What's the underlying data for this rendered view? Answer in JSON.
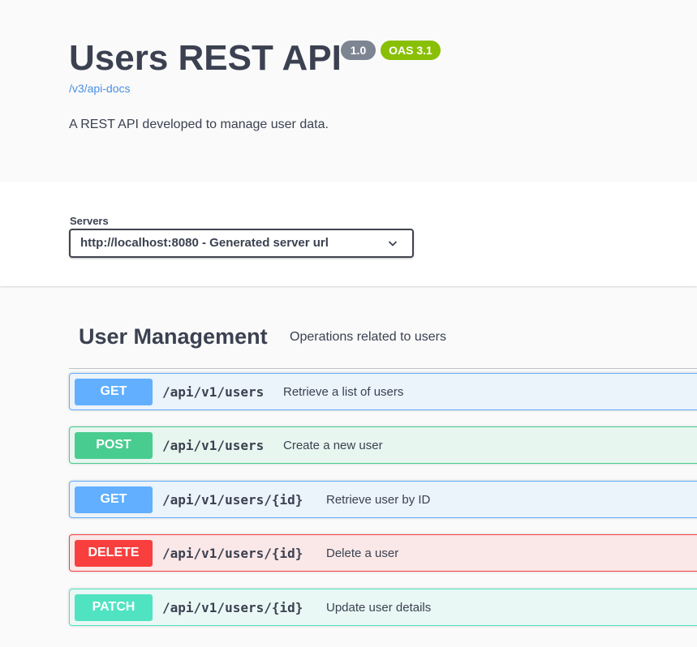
{
  "info": {
    "title": "Users REST API",
    "version_badge": "1.0",
    "oas_badge": "OAS 3.1",
    "spec_link": "/v3/api-docs",
    "description": "A REST API developed to manage user data."
  },
  "servers": {
    "label": "Servers",
    "selected": "http://localhost:8080 - Generated server url"
  },
  "tag": {
    "name": "User Management",
    "description": "Operations related to users"
  },
  "operations": [
    {
      "method": "GET",
      "path": "/api/v1/users",
      "summary": "Retrieve a list of users"
    },
    {
      "method": "POST",
      "path": "/api/v1/users",
      "summary": "Create a new user"
    },
    {
      "method": "GET",
      "path": "/api/v1/users/{id}",
      "summary": "Retrieve user by ID"
    },
    {
      "method": "DELETE",
      "path": "/api/v1/users/{id}",
      "summary": "Delete a user"
    },
    {
      "method": "PATCH",
      "path": "/api/v1/users/{id}",
      "summary": "Update user details"
    }
  ],
  "colors": {
    "get": "#61affe",
    "post": "#49cc90",
    "delete": "#f93e3e",
    "patch": "#50e3c2",
    "version_badge": "#7d8492",
    "oas_badge": "#89bf04",
    "link": "#4990e2"
  }
}
